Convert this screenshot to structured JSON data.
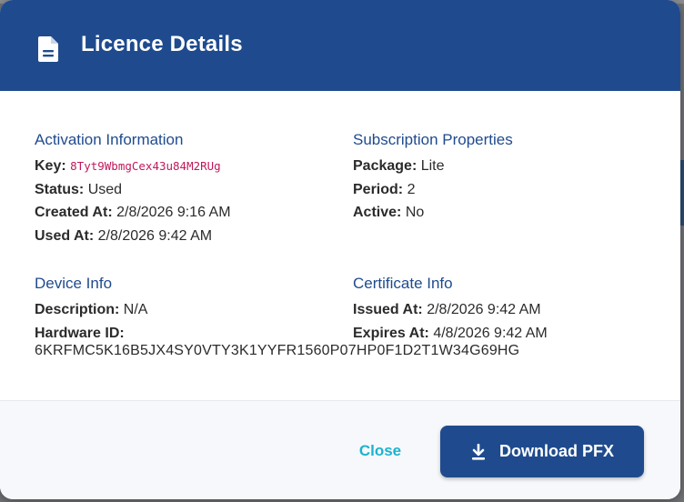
{
  "modal": {
    "title": "Licence Details",
    "header_icon": "document-icon",
    "header_color": "#1f4b8e"
  },
  "activation": {
    "title": "Activation Information",
    "key_label": "Key:",
    "key_value": "8Tyt9WbmgCex43u84M2RUg",
    "status_label": "Status:",
    "status_value": "Used",
    "created_label": "Created At:",
    "created_value": "2/8/2026 9:16 AM",
    "used_label": "Used At:",
    "used_value": "2/8/2026 9:42 AM"
  },
  "subscription": {
    "title": "Subscription Properties",
    "package_label": "Package:",
    "package_value": "Lite",
    "period_label": "Period:",
    "period_value": "2",
    "active_label": "Active:",
    "active_value": "No"
  },
  "device": {
    "title": "Device Info",
    "description_label": "Description:",
    "description_value": "N/A",
    "hardware_label": "Hardware ID:",
    "hardware_value": "6KRFMC5K16B5JX4SY0VTY3K1YYFR1560P07HP0F1D2T1W34G69HG"
  },
  "certificate": {
    "title": "Certificate Info",
    "issued_label": "Issued At:",
    "issued_value": "2/8/2026 9:42 AM",
    "expires_label": "Expires At:",
    "expires_value": "4/8/2026 9:42 AM"
  },
  "footer": {
    "close_label": "Close",
    "download_label": "Download PFX",
    "download_icon": "download-icon",
    "close_color": "#1bb3cf"
  }
}
